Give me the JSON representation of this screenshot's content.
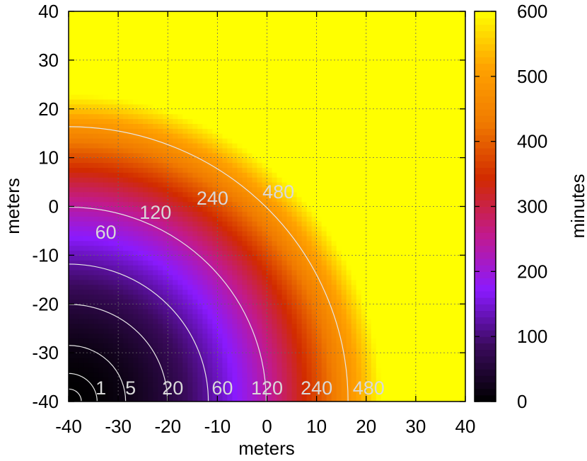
{
  "chart_data": {
    "type": "heatmap",
    "title": "",
    "xlabel": "meters",
    "ylabel": "meters",
    "xlim": [
      -40,
      40
    ],
    "ylim": [
      -40,
      40
    ],
    "x_ticks": [
      "-40",
      "-30",
      "-20",
      "-10",
      "0",
      "10",
      "20",
      "30",
      "40"
    ],
    "y_ticks": [
      "-40",
      "-30",
      "-20",
      "-10",
      "0",
      "10",
      "20",
      "30",
      "40"
    ],
    "grid": true,
    "source_point": [
      -40,
      -40
    ],
    "value_scale": {
      "radius_at_max_m": 63,
      "min_minutes": 0,
      "max_minutes": 600
    },
    "colorbar": {
      "label": "minutes",
      "range": [
        0,
        600
      ],
      "ticks": [
        "0",
        "100",
        "200",
        "300",
        "400",
        "500",
        "600"
      ],
      "colormap": "gnuplot-color",
      "colors": [
        "#000000",
        "#3a0a5c",
        "#8a1aff",
        "#c21a8c",
        "#d12a00",
        "#f07a00",
        "#ffa200",
        "#ffff00"
      ]
    },
    "contours": [
      {
        "minutes": 1,
        "label": "1"
      },
      {
        "minutes": 5,
        "label": "5"
      },
      {
        "minutes": 20,
        "label": "20"
      },
      {
        "minutes": 60,
        "label": "60"
      },
      {
        "minutes": 120,
        "label": "120"
      },
      {
        "minutes": 240,
        "label": "240"
      },
      {
        "minutes": 480,
        "label": "480"
      }
    ],
    "contour_labels_inside": [
      "60",
      "120",
      "240",
      "480"
    ],
    "contour_line_color": "#e6e6e6"
  }
}
